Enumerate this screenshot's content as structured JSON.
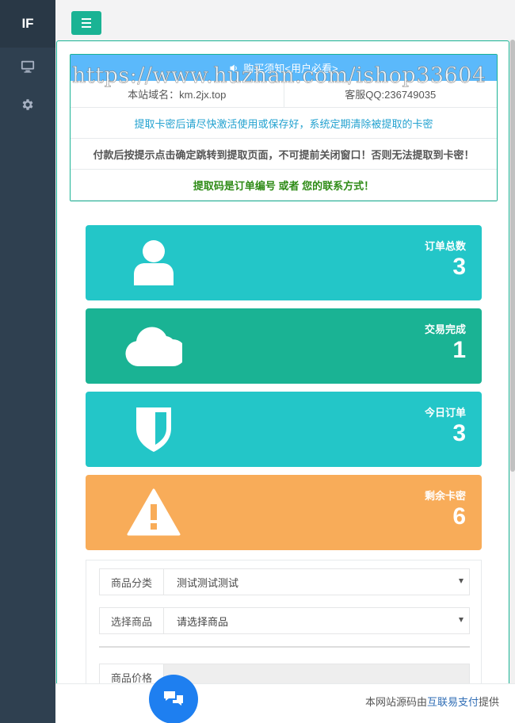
{
  "sidebar": {
    "logo": "IF",
    "items": [
      {
        "icon": "monitor-icon"
      },
      {
        "icon": "gear-icon"
      }
    ]
  },
  "topbar": {
    "menu_icon": "hamburger-icon"
  },
  "notice": {
    "header": "购买须知<用户必看>",
    "domain": "本站域名：km.2jx.top",
    "qq": "客服QQ:236749035",
    "line1": "提取卡密后请尽快激活使用或保存好，系统定期清除被提取的卡密",
    "line2": "付款后按提示点击确定跳转到提取页面，不可提前关闭窗口！否则无法提取到卡密！",
    "line3": "提取码是订单编号 或者 您的联系方式！"
  },
  "watermark": "https://www.huzhan.com/ishop33604",
  "stats": [
    {
      "label": "订单总数",
      "value": "3",
      "icon": "user-icon",
      "color": "#23c6c8"
    },
    {
      "label": "交易完成",
      "value": "1",
      "icon": "cloud-icon",
      "color": "#1ab394"
    },
    {
      "label": "今日订单",
      "value": "3",
      "icon": "shield-icon",
      "color": "#23c6c8"
    },
    {
      "label": "剩余卡密",
      "value": "6",
      "icon": "warning-icon",
      "color": "#f8ac59"
    }
  ],
  "form": {
    "category_label": "商品分类",
    "category_value": "测试测试测试",
    "product_label": "选择商品",
    "product_value": "请选择商品",
    "price_label": "商品价格"
  },
  "footer": {
    "prefix": "本网站源码由",
    "link": "互联易支付",
    "suffix": "提供"
  },
  "colors": {
    "accent": "#1ab394",
    "sidebar": "#2f4050",
    "notice_header": "#5bb9fb",
    "chat": "#1e7ff0"
  }
}
